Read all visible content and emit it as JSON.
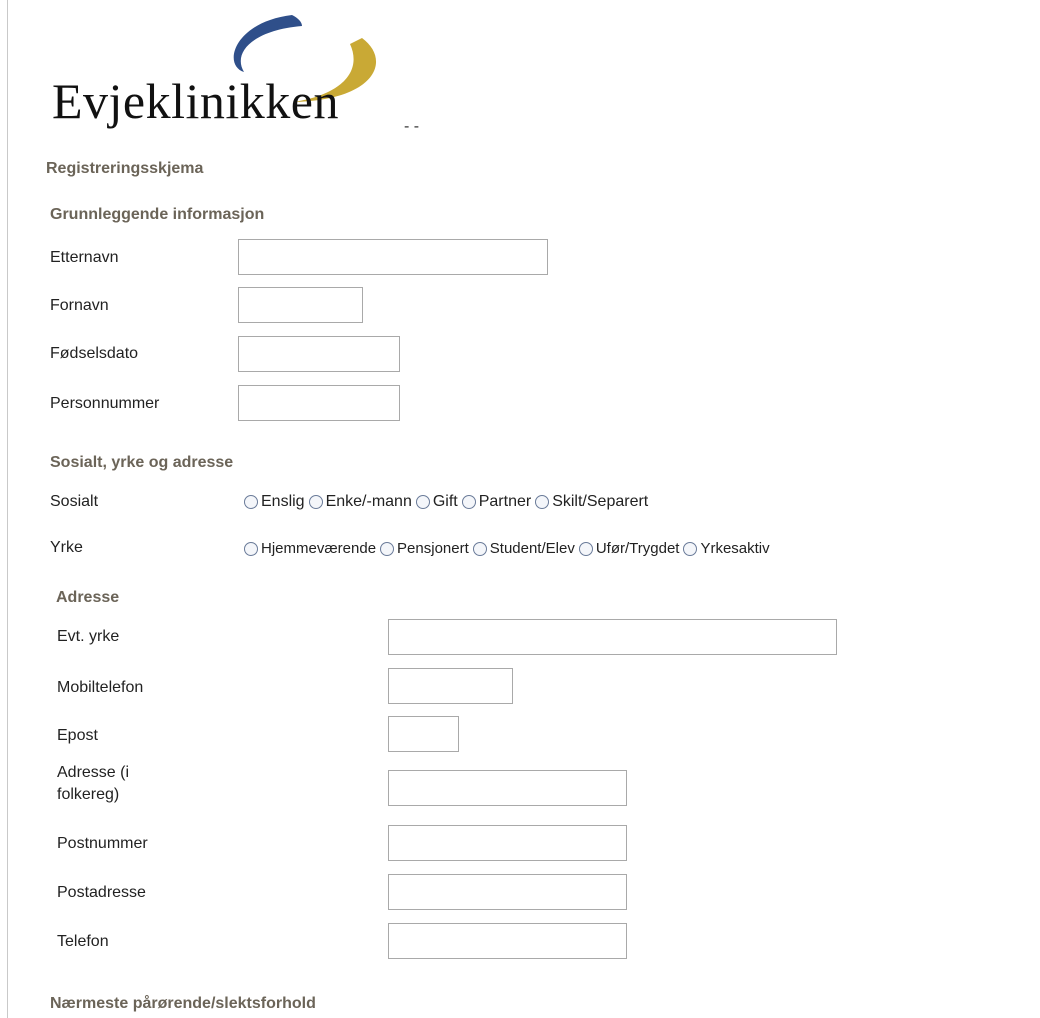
{
  "brand": {
    "name": "Evjeklinikken",
    "swoosh_blue": "#2f4f8a",
    "swoosh_gold": "#c9a935"
  },
  "dashes": "- -",
  "form_title": "Registreringsskjema",
  "basic": {
    "heading": "Grunnleggende informasjon",
    "etternavn_label": "Etternavn",
    "fornavn_label": "Fornavn",
    "fodselsdato_label": "Fødselsdato",
    "personnummer_label": "Personnummer",
    "etternavn_value": "",
    "fornavn_value": "",
    "fodselsdato_value": "",
    "personnummer_value": ""
  },
  "social": {
    "heading": "Sosialt, yrke og adresse",
    "sosialt_label": "Sosialt",
    "sosialt_options": [
      "Enslig",
      "Enke/-mann",
      "Gift",
      "Partner",
      "Skilt/Separert"
    ],
    "yrke_label": "Yrke",
    "yrke_options": [
      "Hjemmeværende",
      "Pensjonert",
      "Student/Elev",
      "Ufør/Trygdet",
      "Yrkesaktiv"
    ]
  },
  "address": {
    "heading": "Adresse",
    "evt_yrke_label": "Evt. yrke",
    "mobiltelefon_label": "Mobiltelefon",
    "epost_label": "Epost",
    "adresse_label_line1": "Adresse (i",
    "adresse_label_line2": "folkereg)",
    "postnummer_label": "Postnummer",
    "postadresse_label": "Postadresse",
    "telefon_label": "Telefon"
  },
  "relatives": {
    "heading": "Nærmeste pårørende/slektsforhold"
  }
}
